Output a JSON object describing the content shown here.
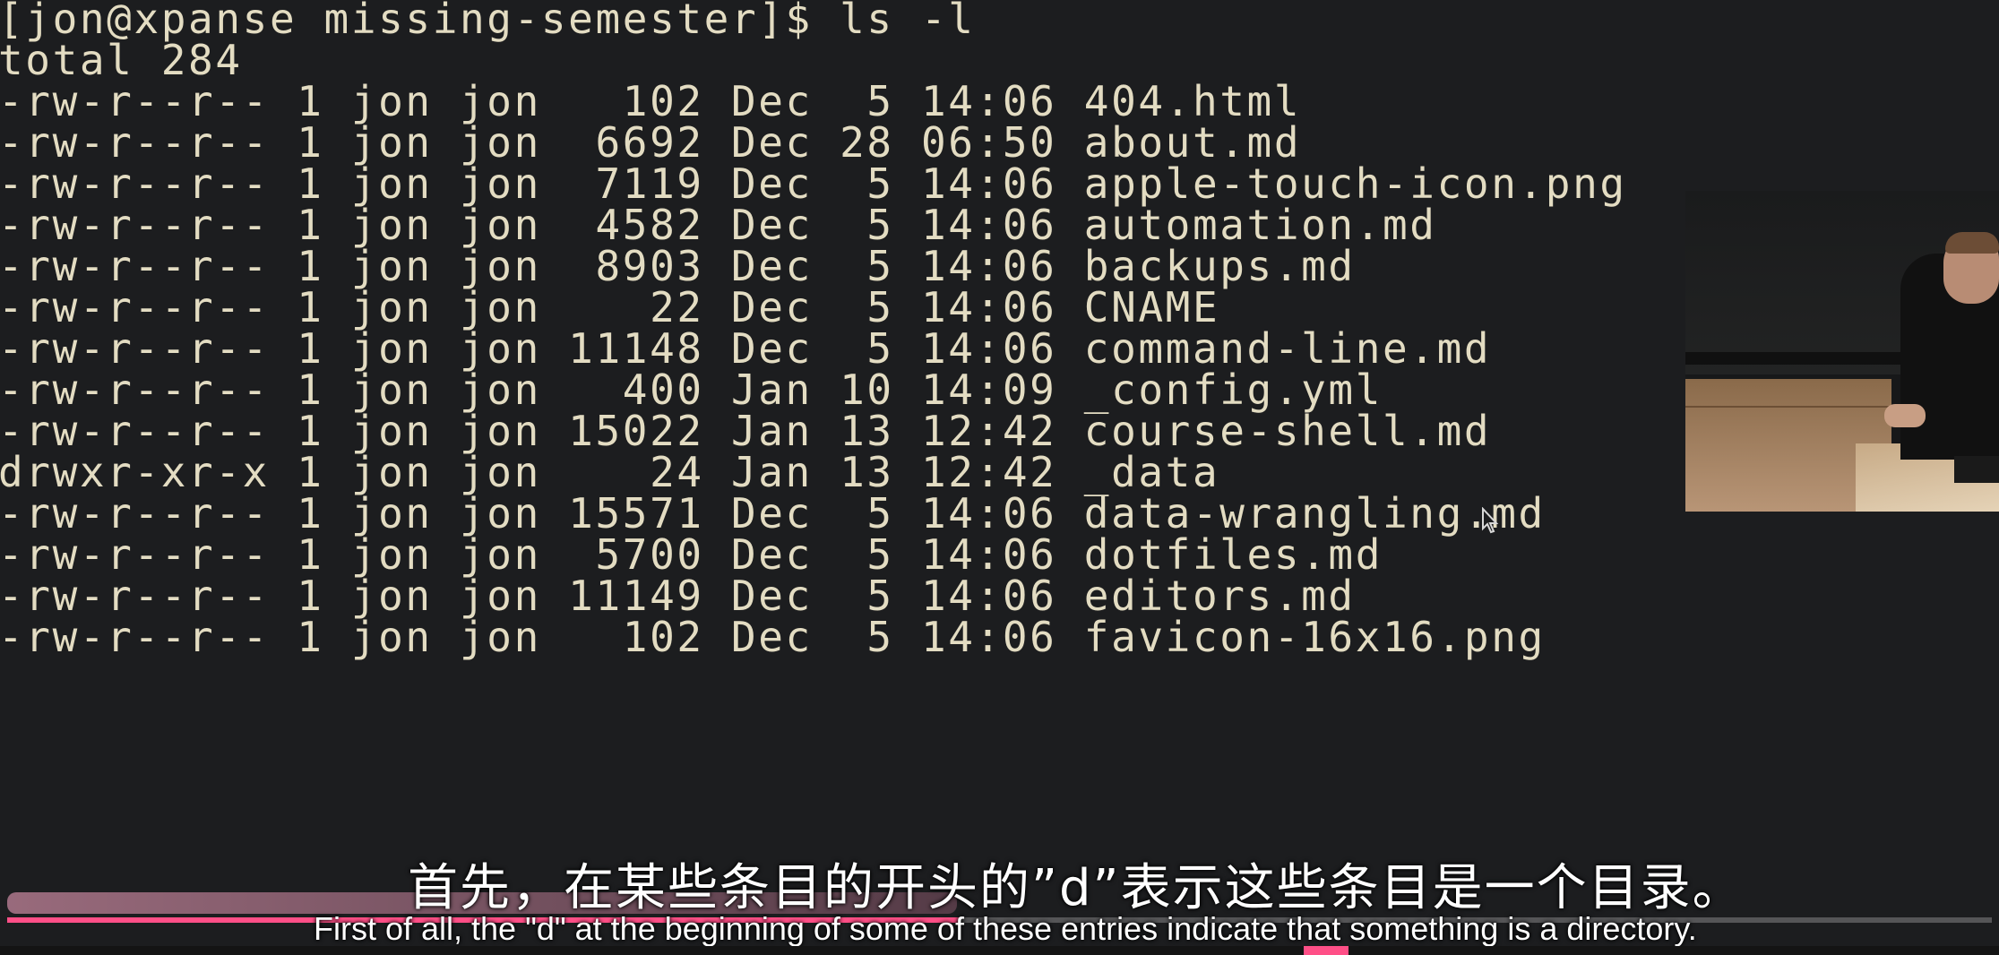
{
  "terminal": {
    "prompt": "[jon@xpanse missing-semester]$ ls -l",
    "total": "total 284",
    "rows": [
      "-rw-r--r-- 1 jon jon   102 Dec  5 14:06 404.html",
      "-rw-r--r-- 1 jon jon  6692 Dec 28 06:50 about.md",
      "-rw-r--r-- 1 jon jon  7119 Dec  5 14:06 apple-touch-icon.png",
      "-rw-r--r-- 1 jon jon  4582 Dec  5 14:06 automation.md",
      "-rw-r--r-- 1 jon jon  8903 Dec  5 14:06 backups.md",
      "-rw-r--r-- 1 jon jon    22 Dec  5 14:06 CNAME",
      "-rw-r--r-- 1 jon jon 11148 Dec  5 14:06 command-line.md",
      "-rw-r--r-- 1 jon jon   400 Jan 10 14:09 _config.yml",
      "-rw-r--r-- 1 jon jon 15022 Jan 13 12:42 course-shell.md",
      "drwxr-xr-x 1 jon jon    24 Jan 13 12:42 _data",
      "-rw-r--r-- 1 jon jon 15571 Dec  5 14:06 data-wrangling.md",
      "-rw-r--r-- 1 jon jon  5700 Dec  5 14:06 dotfiles.md",
      "-rw-r--r-- 1 jon jon 11149 Dec  5 14:06 editors.md",
      "-rw-r--r-- 1 jon jon   102 Dec  5 14:06 favicon-16x16.png"
    ]
  },
  "subtitles": {
    "zh": "首先，在某些条目的开头的”d”表示这些条目是一个目录。",
    "en": "First of all, the \"d\" at the beginning of some of these entries indicate that something is a directory."
  },
  "player": {
    "progress_fraction": 0.48
  },
  "colors": {
    "background": "#1c1d1f",
    "terminal_text": "#e3dcc2",
    "progress_accent": "#ff4f87"
  },
  "icons": {
    "cursor": "mouse-pointer-icon"
  }
}
